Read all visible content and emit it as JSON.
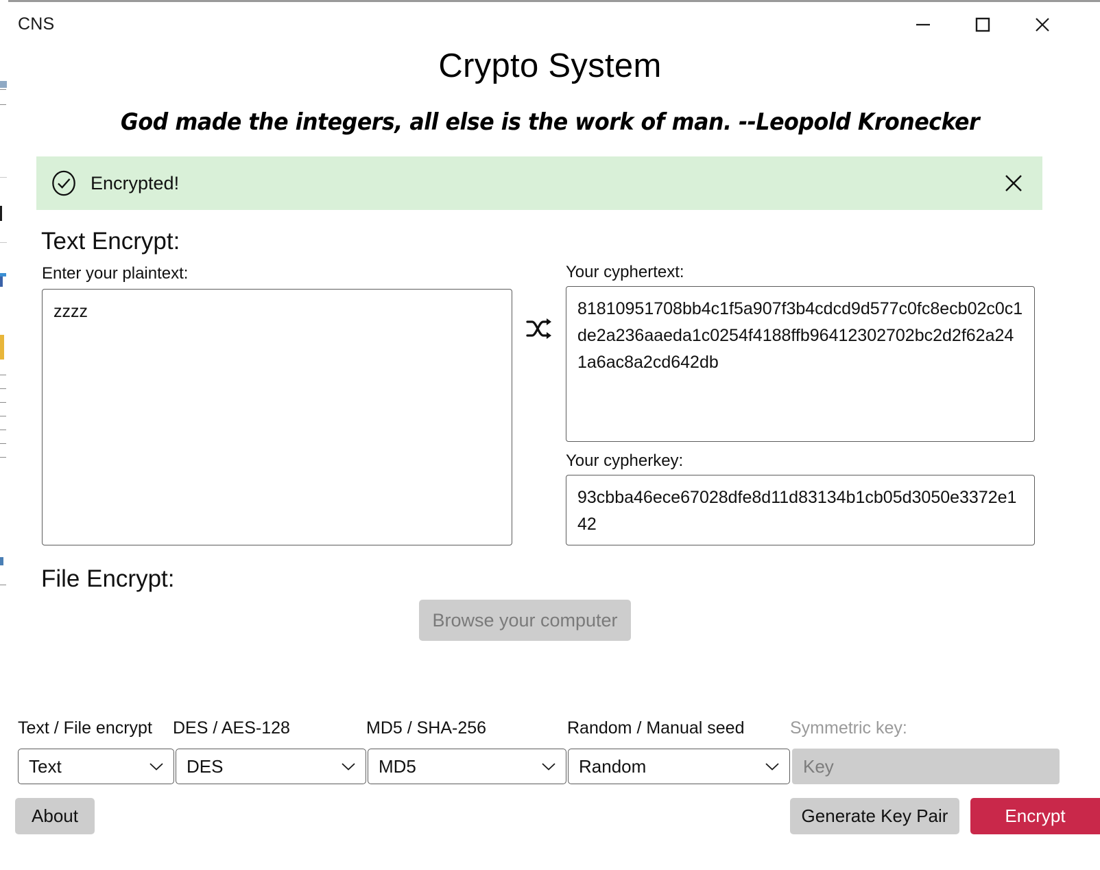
{
  "window": {
    "title": "CNS",
    "controls": {
      "minimize": "minimize-icon",
      "maximize": "maximize-icon",
      "close": "close-icon"
    }
  },
  "header": {
    "title": "Crypto System",
    "quote": "God made the integers, all else is the work of man. --Leopold Kronecker"
  },
  "alert": {
    "icon": "check-circle-icon",
    "message": "Encrypted!",
    "close_icon": "close-icon",
    "background_color": "#d9f0d8"
  },
  "text_encrypt": {
    "heading": "Text Encrypt:",
    "plaintext_label": "Enter your plaintext:",
    "plaintext_value": "zzzz",
    "transform_icon": "shuffle-icon",
    "cyphertext_label": "Your cyphertext:",
    "cyphertext_value": "81810951708bb4c1f5a907f3b4cdcd9d577c0fc8ecb02c0c1de2a236aaeda1c0254f4188ffb96412302702bc2d2f62a241a6ac8a2cd642db",
    "cypherkey_label": "Your cypherkey:",
    "cypherkey_value": "93cbba46ece67028dfe8d11d83134b1cb05d3050e3372e142"
  },
  "file_encrypt": {
    "heading": "File Encrypt:",
    "browse_label": "Browse your computer"
  },
  "controls": {
    "labels": [
      "Text / File encrypt",
      "DES / AES-128",
      "MD5 / SHA-256",
      "Random / Manual seed",
      "Symmetric key:"
    ],
    "mode_value": "Text",
    "cipher_value": "DES",
    "hash_value": "MD5",
    "seed_value": "Random",
    "symmetric_key_placeholder": "Key"
  },
  "footer": {
    "about_label": "About",
    "generate_key_pair_label": "Generate Key Pair",
    "encrypt_label": "Encrypt",
    "encrypt_color": "#c9284a"
  }
}
